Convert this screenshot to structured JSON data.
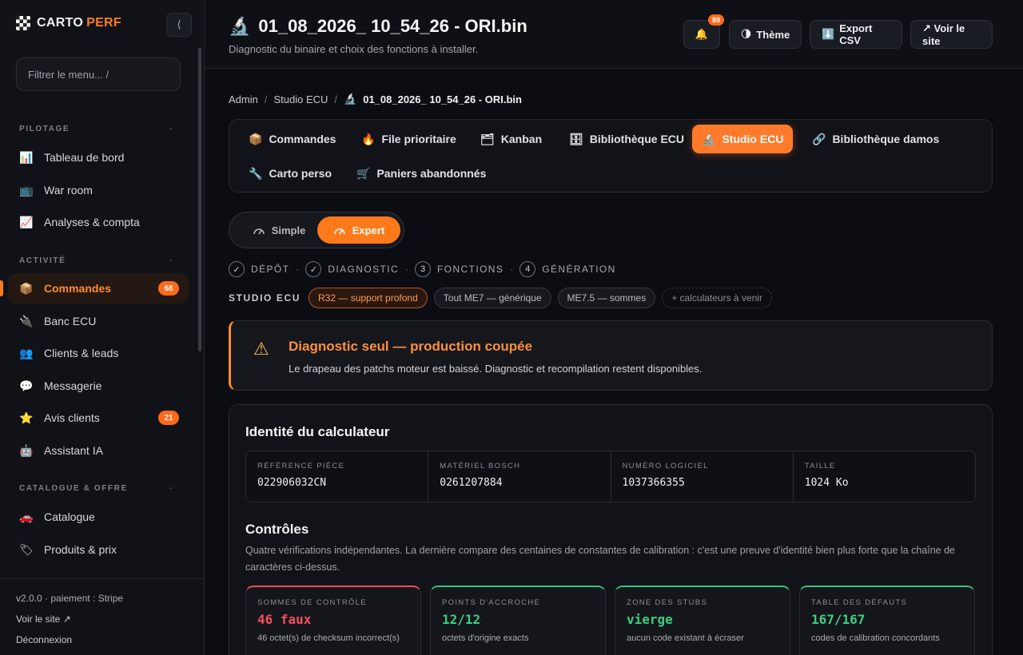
{
  "brand": {
    "part1": "CARTO",
    "part2": "PERF"
  },
  "sidebar": {
    "collapse_label": "⟨",
    "filter_placeholder": "Filtrer le menu...    /",
    "sections": [
      {
        "title": "PILOTAGE",
        "items": [
          {
            "label": "Tableau de bord",
            "icon": "📊"
          },
          {
            "label": "War room",
            "icon": "📺"
          },
          {
            "label": "Analyses & compta",
            "icon": "📈"
          }
        ]
      },
      {
        "title": "ACTIVITÉ",
        "items": [
          {
            "label": "Commandes",
            "icon": "📦",
            "badge": "68"
          },
          {
            "label": "Banc ECU",
            "icon": "🔌"
          },
          {
            "label": "Clients & leads",
            "icon": "👥"
          },
          {
            "label": "Messagerie",
            "icon": "💬"
          },
          {
            "label": "Avis clients",
            "icon": "⭐",
            "badge": "21"
          },
          {
            "label": "Assistant IA",
            "icon": "🤖"
          }
        ]
      },
      {
        "title": "CATALOGUE & OFFRE",
        "items": [
          {
            "label": "Catalogue",
            "icon": "🚗"
          },
          {
            "label": "Produits & prix",
            "icon": "🏷"
          }
        ]
      }
    ],
    "caret": "-",
    "footer": {
      "version": "v2.0.0 · paiement : Stripe",
      "site_link": "Voir le site ↗",
      "logout": "Déconnexion"
    }
  },
  "header": {
    "title_icon": "🔬",
    "title": "01_08_2026_ 10_54_26 - ORI.bin",
    "subtitle": "Diagnostic du binaire et choix des fonctions à installer.",
    "notif_icon": "🔔",
    "notif_count": "89",
    "theme_icon": "🌗",
    "theme_label": "Thème",
    "export_icon": "⬇️",
    "export_label": "Export CSV",
    "site_label": "↗ Voir le site"
  },
  "breadcrumb": {
    "items": [
      "Admin",
      "Studio ECU"
    ],
    "current_icon": "🔬",
    "current": "01_08_2026_ 10_54_26 - ORI.bin",
    "sep": "/"
  },
  "tabs": [
    {
      "icon": "📦",
      "label": "Commandes"
    },
    {
      "icon": "🔥",
      "label": "File prioritaire"
    },
    {
      "icon": "🗂",
      "label": "Kanban"
    },
    {
      "icon": "🗄",
      "label": "Bibliothèque ECU"
    },
    {
      "icon": "🔬",
      "label": "Studio ECU",
      "active": true
    },
    {
      "icon": "🔗",
      "label": "Bibliothèque damos"
    },
    {
      "icon": "🔧",
      "label": "Carto perso"
    },
    {
      "icon": "🛒",
      "label": "Paniers abandonnés"
    }
  ],
  "mode": {
    "simple": "Simple",
    "expert": "Expert",
    "selected": "Expert"
  },
  "steps": [
    {
      "mark": "✓",
      "label": "DÉPÔT"
    },
    {
      "mark": "✓",
      "label": "DIAGNOSTIC"
    },
    {
      "mark": "3",
      "label": "FONCTIONS"
    },
    {
      "mark": "4",
      "label": "GÉNÉRATION"
    }
  ],
  "step_sep": "·",
  "studio": {
    "label": "STUDIO ECU",
    "chips": [
      "R32 — support profond",
      "Tout ME7 — générique",
      "ME7.5 — sommes",
      "+ calculateurs à venir"
    ]
  },
  "alert": {
    "icon": "⚠",
    "title": "Diagnostic seul — production coupée",
    "text": "Le drapeau des patchs moteur est baissé. Diagnostic et recompilation restent disponibles."
  },
  "identity": {
    "title": "Identité du calculateur",
    "fields": [
      {
        "key": "RÉFÉRENCE PIÈCE",
        "value": "022906032CN"
      },
      {
        "key": "MATÉRIEL BOSCH",
        "value": "0261207884"
      },
      {
        "key": "NUMÉRO LOGICIEL",
        "value": "1037366355"
      },
      {
        "key": "TAILLE",
        "value": "1024 Ko"
      }
    ]
  },
  "controls": {
    "title": "Contrôles",
    "description": "Quatre vérifications indépendantes. La dernière compare des centaines de constantes de calibration : c'est une preuve d'identité bien plus forte que la chaîne de caractères ci-dessus.",
    "items": [
      {
        "key": "SOMMES DE CONTRÔLE",
        "value": "46 faux",
        "desc": "46 octet(s) de checksum incorrect(s)",
        "status": "bad"
      },
      {
        "key": "POINTS D'ACCROCHE",
        "value": "12/12",
        "desc": "octets d'origine exacts",
        "status": "good"
      },
      {
        "key": "ZONE DES STUBS",
        "value": "vierge",
        "desc": "aucun code existant à écraser",
        "status": "good"
      },
      {
        "key": "TABLE DES DÉFAUTS",
        "value": "167/167",
        "desc": "codes de calibration concordants",
        "status": "good"
      }
    ]
  }
}
